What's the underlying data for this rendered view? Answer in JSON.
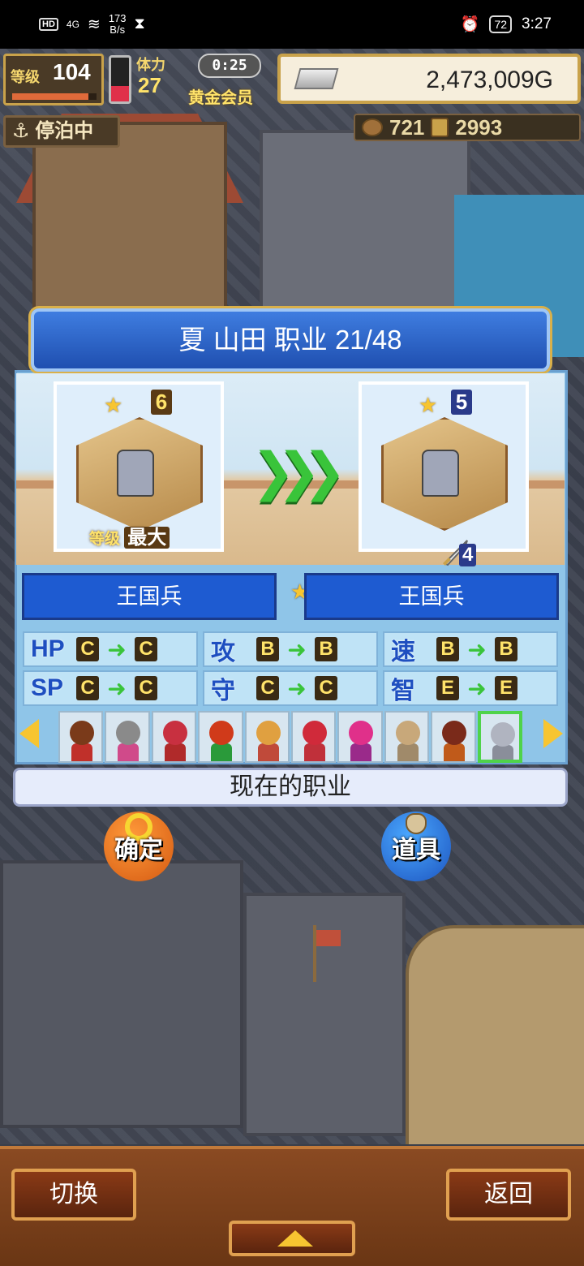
{
  "status_bar": {
    "hd_tag": "HD",
    "signal": "4G",
    "net_speed": "173",
    "net_unit": "B/s",
    "battery": "72",
    "time": "3:27"
  },
  "hud": {
    "level_label": "等级",
    "level": "104",
    "level_progress": 0.9,
    "stamina_label": "体力",
    "stamina": "27",
    "stamina_fill": 0.35,
    "timer": "0:25",
    "membership": "黄金会员",
    "gold": "2,473,009G",
    "docked": "停泊中",
    "resource_1": "721",
    "resource_2": "2993"
  },
  "dialog": {
    "title": "夏 山田 职业 21/48",
    "current": {
      "grade": "6",
      "level_label": "等级",
      "level_value": "最大"
    },
    "next": {
      "grade": "5",
      "equip_count": "4"
    },
    "job_from": "王国兵",
    "job_to": "王国兵",
    "stats": [
      {
        "name": "HP",
        "from": "C",
        "to": "C"
      },
      {
        "name": "攻",
        "from": "B",
        "to": "B"
      },
      {
        "name": "速",
        "from": "B",
        "to": "B"
      },
      {
        "name": "SP",
        "from": "C",
        "to": "C"
      },
      {
        "name": "守",
        "from": "C",
        "to": "C"
      },
      {
        "name": "智",
        "from": "E",
        "to": "E"
      }
    ],
    "roster": [
      {
        "hair": "#7a3a1a",
        "body": "#c0302a"
      },
      {
        "hair": "#8a8a8a",
        "body": "#d04a8a"
      },
      {
        "hair": "#c83040",
        "body": "#b02a2a"
      },
      {
        "hair": "#d03a1a",
        "body": "#2a9a3a"
      },
      {
        "hair": "#e0a040",
        "body": "#c04a3a"
      },
      {
        "hair": "#d02a3a",
        "body": "#c0303a"
      },
      {
        "hair": "#e0308a",
        "body": "#9a2a8a"
      },
      {
        "hair": "#c8a87a",
        "body": "#a08a6a"
      },
      {
        "hair": "#7a2a1a",
        "body": "#c05a1a"
      },
      {
        "hair": "#b0b4c0",
        "body": "#8a8e9a"
      }
    ],
    "selected_index": 9,
    "current_job_label": "现在的职业"
  },
  "actions": {
    "confirm": "确定",
    "items": "道具",
    "switch": "切换",
    "back": "返回"
  }
}
